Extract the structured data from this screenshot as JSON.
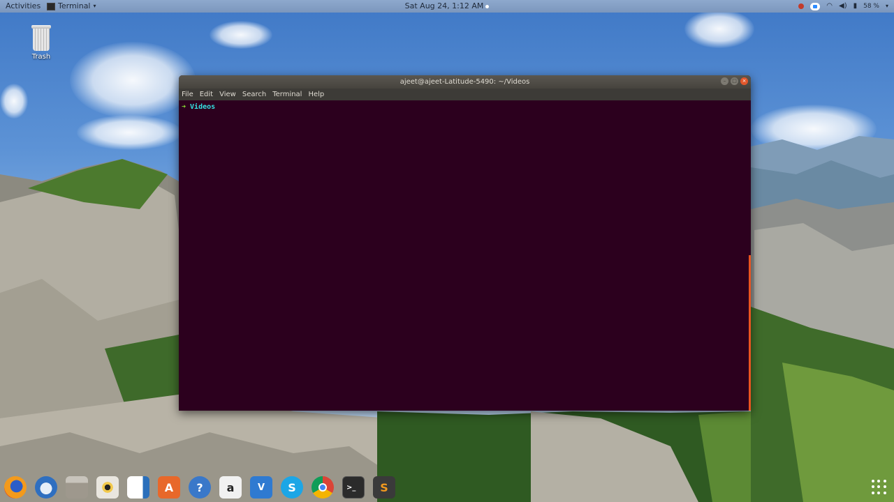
{
  "topbar": {
    "activities": "Activities",
    "app_menu": "Terminal",
    "clock": "Sat Aug 24,  1:12 AM",
    "battery": "58 %"
  },
  "desktop": {
    "trash_label": "Trash"
  },
  "terminal": {
    "title": "ajeet@ajeet-Latitude-5490: ~/Videos",
    "menu": [
      "File",
      "Edit",
      "View",
      "Search",
      "Terminal",
      "Help"
    ],
    "prompt_arrow": "➜",
    "prompt_dir": "Videos"
  },
  "dock": {
    "items": [
      "firefox-icon",
      "thunderbird-icon",
      "files-icon",
      "rhythmbox-icon",
      "libreoffice-writer-icon",
      "ubuntu-software-icon",
      "help-icon",
      "amazon-icon",
      "vscode-icon",
      "skype-icon",
      "chrome-icon",
      "terminal-icon",
      "sublime-text-icon"
    ]
  },
  "colors": {
    "terminal_bg": "#2c001e",
    "prompt_arrow": "#8ae234",
    "prompt_dir": "#34e2e2",
    "accent": "#e95420"
  }
}
